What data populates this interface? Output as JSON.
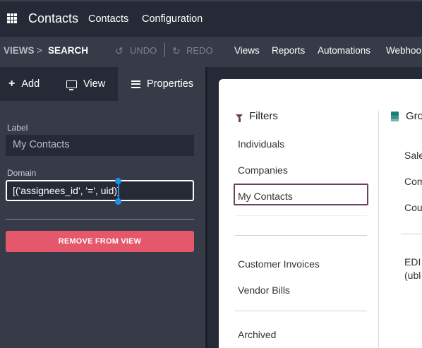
{
  "navbar": {
    "brand": "Contacts",
    "menu": [
      "Contacts",
      "Configuration"
    ]
  },
  "studio": {
    "breadcrumb": [
      "VIEWS",
      ">",
      "SEARCH"
    ],
    "undo_label": "UNDO",
    "redo_label": "REDO",
    "menu": [
      "Views",
      "Reports",
      "Automations",
      "Webhoo"
    ]
  },
  "sidebar": {
    "tabs": [
      "Add",
      "View",
      "Properties"
    ],
    "active_tab": "Properties",
    "label_caption": "Label",
    "label_value": "My Contacts",
    "domain_caption": "Domain",
    "domain_value": "[('assignees_id', '=', uid)]",
    "remove_button": "REMOVE FROM VIEW"
  },
  "canvas": {
    "filters_title": "Filters",
    "filters": [
      "Individuals",
      "Companies",
      "My Contacts",
      "Customer Invoices",
      "Vendor Bills",
      "Archived"
    ],
    "selected_filter": "My Contacts",
    "group_title": "Gro",
    "group_items": [
      "Sale",
      "Com",
      "Cou",
      "EDI",
      "(ubl"
    ]
  },
  "colors": {
    "accent": "#6e3e5f",
    "danger": "#e5576a",
    "selection": "#1a93e8",
    "group_icon": "#1a7f78"
  }
}
